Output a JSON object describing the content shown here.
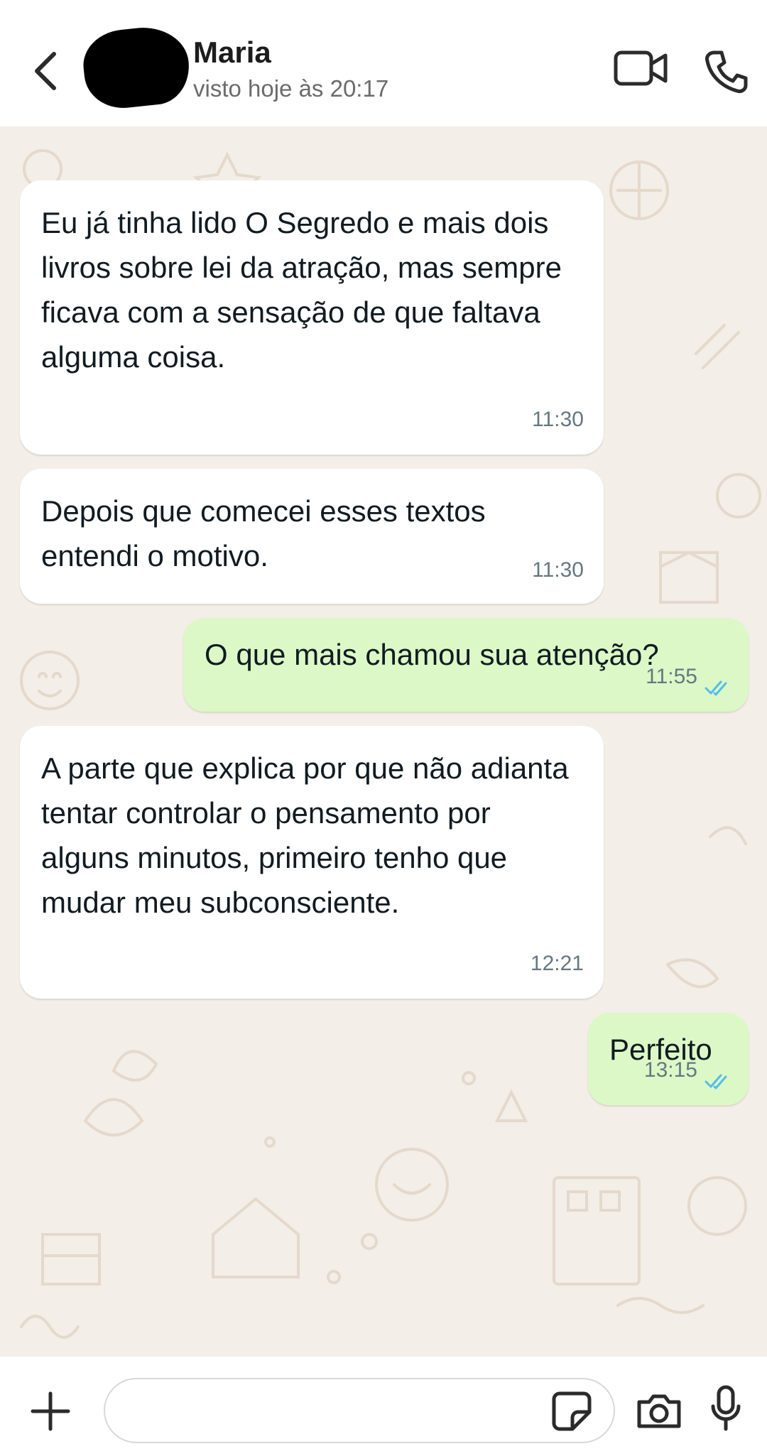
{
  "header": {
    "contact_name": "Maria",
    "last_seen": "visto hoje às 20:17"
  },
  "messages": [
    {
      "direction": "incoming",
      "text": "Eu já tinha lido O Segredo e mais dois livros sobre lei da atração, mas sempre ficava com a sensação de que faltava alguma coisa.",
      "time": "11:30"
    },
    {
      "direction": "incoming",
      "text": "Depois que comecei esses textos entendi o motivo.",
      "time": "11:30"
    },
    {
      "direction": "outgoing",
      "text": "O que mais chamou sua atenção?",
      "time": "11:55",
      "status": "read"
    },
    {
      "direction": "incoming",
      "text": "A parte que explica por que não adianta tentar controlar o pensamento por alguns minutos, primeiro tenho que mudar meu subconsciente.",
      "time": "12:21"
    },
    {
      "direction": "outgoing",
      "text": "Perfeito",
      "time": "13:15",
      "status": "read"
    }
  ],
  "footer": {
    "input_value": "",
    "input_placeholder": ""
  },
  "colors": {
    "incoming_bubble": "#ffffff",
    "outgoing_bubble": "#dcf8c6",
    "read_ticks": "#53bdeb",
    "chat_background": "#f3eee7"
  },
  "icons": [
    "back-arrow-icon",
    "video-call-icon",
    "phone-icon",
    "plus-icon",
    "sticker-icon",
    "camera-icon",
    "microphone-icon",
    "double-check-icon"
  ]
}
